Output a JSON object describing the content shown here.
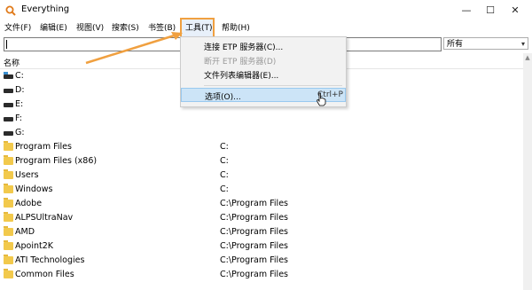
{
  "window": {
    "title": "Everything",
    "minimize": "—",
    "maximize": "☐",
    "close": "✕"
  },
  "menu": [
    "文件(F)",
    "编辑(E)",
    "视图(V)",
    "搜索(S)",
    "书签(B)",
    "工具(T)",
    "帮助(H)"
  ],
  "search": {
    "value": "",
    "filter": "所有"
  },
  "columns": {
    "name": "名称"
  },
  "rows": [
    {
      "name": "C:",
      "path": "",
      "icon": "system-drive-icon"
    },
    {
      "name": "D:",
      "path": "",
      "icon": "drive-icon"
    },
    {
      "name": "E:",
      "path": "",
      "icon": "drive-icon"
    },
    {
      "name": "F:",
      "path": "",
      "icon": "drive-icon"
    },
    {
      "name": "G:",
      "path": "",
      "icon": "drive-icon"
    },
    {
      "name": "Program Files",
      "path": "C:",
      "icon": "folder-icon"
    },
    {
      "name": "Program Files (x86)",
      "path": "C:",
      "icon": "folder-icon"
    },
    {
      "name": "Users",
      "path": "C:",
      "icon": "folder-icon"
    },
    {
      "name": "Windows",
      "path": "C:",
      "icon": "folder-icon"
    },
    {
      "name": "Adobe",
      "path": "C:\\Program Files",
      "icon": "folder-icon"
    },
    {
      "name": "ALPSUltraNav",
      "path": "C:\\Program Files",
      "icon": "folder-icon"
    },
    {
      "name": "AMD",
      "path": "C:\\Program Files",
      "icon": "folder-icon"
    },
    {
      "name": "Apoint2K",
      "path": "C:\\Program Files",
      "icon": "folder-icon"
    },
    {
      "name": "ATI Technologies",
      "path": "C:\\Program Files",
      "icon": "folder-icon"
    },
    {
      "name": "Common Files",
      "path": "C:\\Program Files",
      "icon": "folder-icon"
    }
  ],
  "tools_menu": [
    {
      "label": "连接 ETP 服务器(C)...",
      "disabled": false,
      "shortcut": ""
    },
    {
      "label": "断开 ETP 服务器(D)",
      "disabled": true,
      "shortcut": ""
    },
    {
      "label": "文件列表编辑器(E)...",
      "disabled": false,
      "shortcut": ""
    },
    {
      "label": "选项(O)...",
      "disabled": false,
      "shortcut": "Ctrl+P",
      "selected": true
    }
  ],
  "colors": {
    "annotation": "#f0a040",
    "selection": "#cce4f7",
    "folder": "#f2c94c"
  }
}
